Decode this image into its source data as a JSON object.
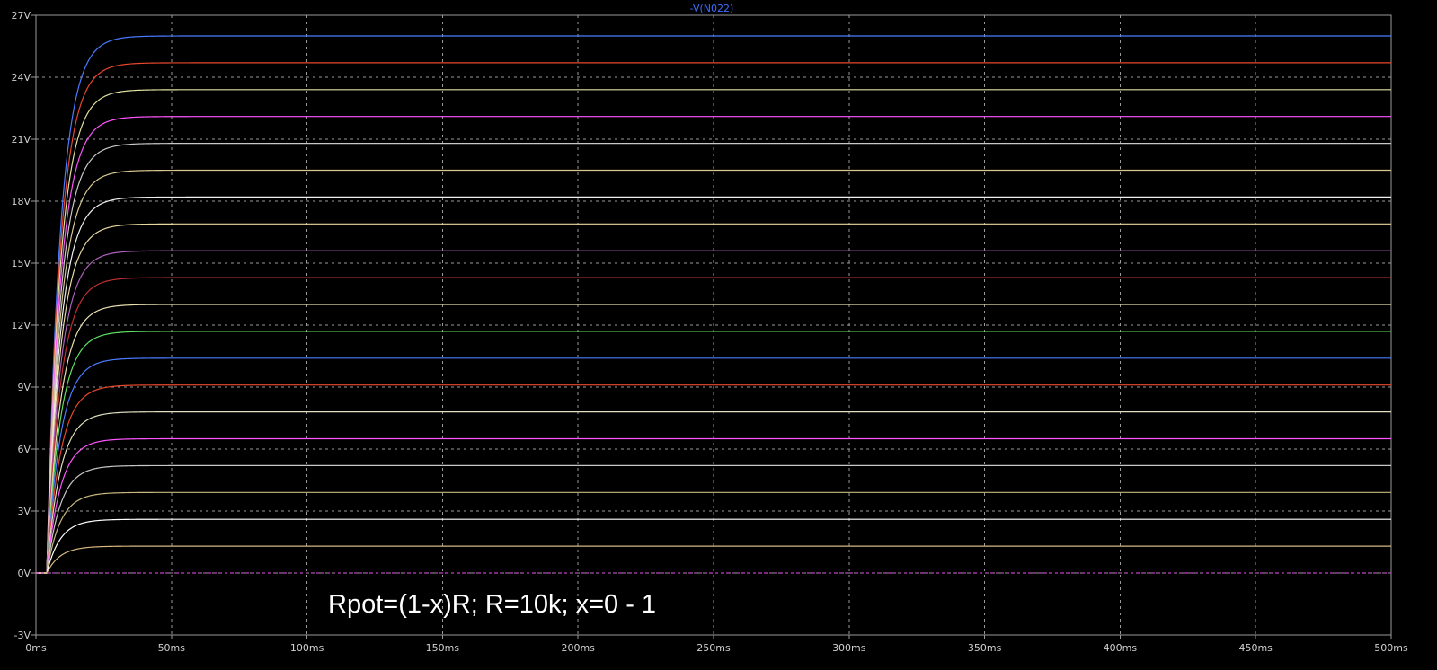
{
  "window": {
    "trace_label": "-V(N022)",
    "annotation": "Rpot=(1-x)R; R=10k; x=0 - 1",
    "background": "#000000",
    "grid_color": "#9a9a9a",
    "frame_color": "#9a9a9a",
    "title_color": "#3d6cff"
  },
  "chart_data": {
    "type": "line",
    "title": "-V(N022)",
    "xlabel": "",
    "ylabel": "",
    "x_unit": "ms",
    "y_unit": "V",
    "xlim": [
      0,
      500
    ],
    "ylim": [
      -3,
      27
    ],
    "x_ticks": [
      0,
      50,
      100,
      150,
      200,
      250,
      300,
      350,
      400,
      450,
      500
    ],
    "x_tick_labels": [
      "0ms",
      "50ms",
      "100ms",
      "150ms",
      "200ms",
      "250ms",
      "300ms",
      "350ms",
      "400ms",
      "450ms",
      "500ms"
    ],
    "y_ticks": [
      -3,
      0,
      3,
      6,
      9,
      12,
      15,
      18,
      21,
      24,
      27
    ],
    "y_tick_labels": [
      "-3V",
      "0V",
      "3V",
      "6V",
      "9V",
      "12V",
      "15V",
      "18V",
      "21V",
      "24V",
      "27V"
    ],
    "grid": true,
    "legend": "none",
    "step_start_ms": 4,
    "time_constant_ms": 5,
    "series": [
      {
        "steady_state": 26.0,
        "color": "#4a7cff"
      },
      {
        "steady_state": 24.7,
        "color": "#e8482c"
      },
      {
        "steady_state": 23.4,
        "color": "#e0e0a0"
      },
      {
        "steady_state": 22.1,
        "color": "#ff55ff"
      },
      {
        "steady_state": 20.8,
        "color": "#c8c8c8"
      },
      {
        "steady_state": 19.5,
        "color": "#d8c890"
      },
      {
        "steady_state": 18.2,
        "color": "#f0f0f0"
      },
      {
        "steady_state": 16.9,
        "color": "#e8d8a0"
      },
      {
        "steady_state": 15.6,
        "color": "#b060c0"
      },
      {
        "steady_state": 14.3,
        "color": "#c03030"
      },
      {
        "steady_state": 13.0,
        "color": "#e8e0b0"
      },
      {
        "steady_state": 11.7,
        "color": "#60e060"
      },
      {
        "steady_state": 10.4,
        "color": "#4a7cff"
      },
      {
        "steady_state": 9.1,
        "color": "#e8482c"
      },
      {
        "steady_state": 7.8,
        "color": "#e0e0c0"
      },
      {
        "steady_state": 6.5,
        "color": "#ff55ff"
      },
      {
        "steady_state": 5.2,
        "color": "#c8c8c8"
      },
      {
        "steady_state": 3.9,
        "color": "#c8b880"
      },
      {
        "steady_state": 2.6,
        "color": "#ffffff"
      },
      {
        "steady_state": 1.3,
        "color": "#d8b880"
      },
      {
        "steady_state": 0.0,
        "color": "#c040c0"
      }
    ]
  }
}
